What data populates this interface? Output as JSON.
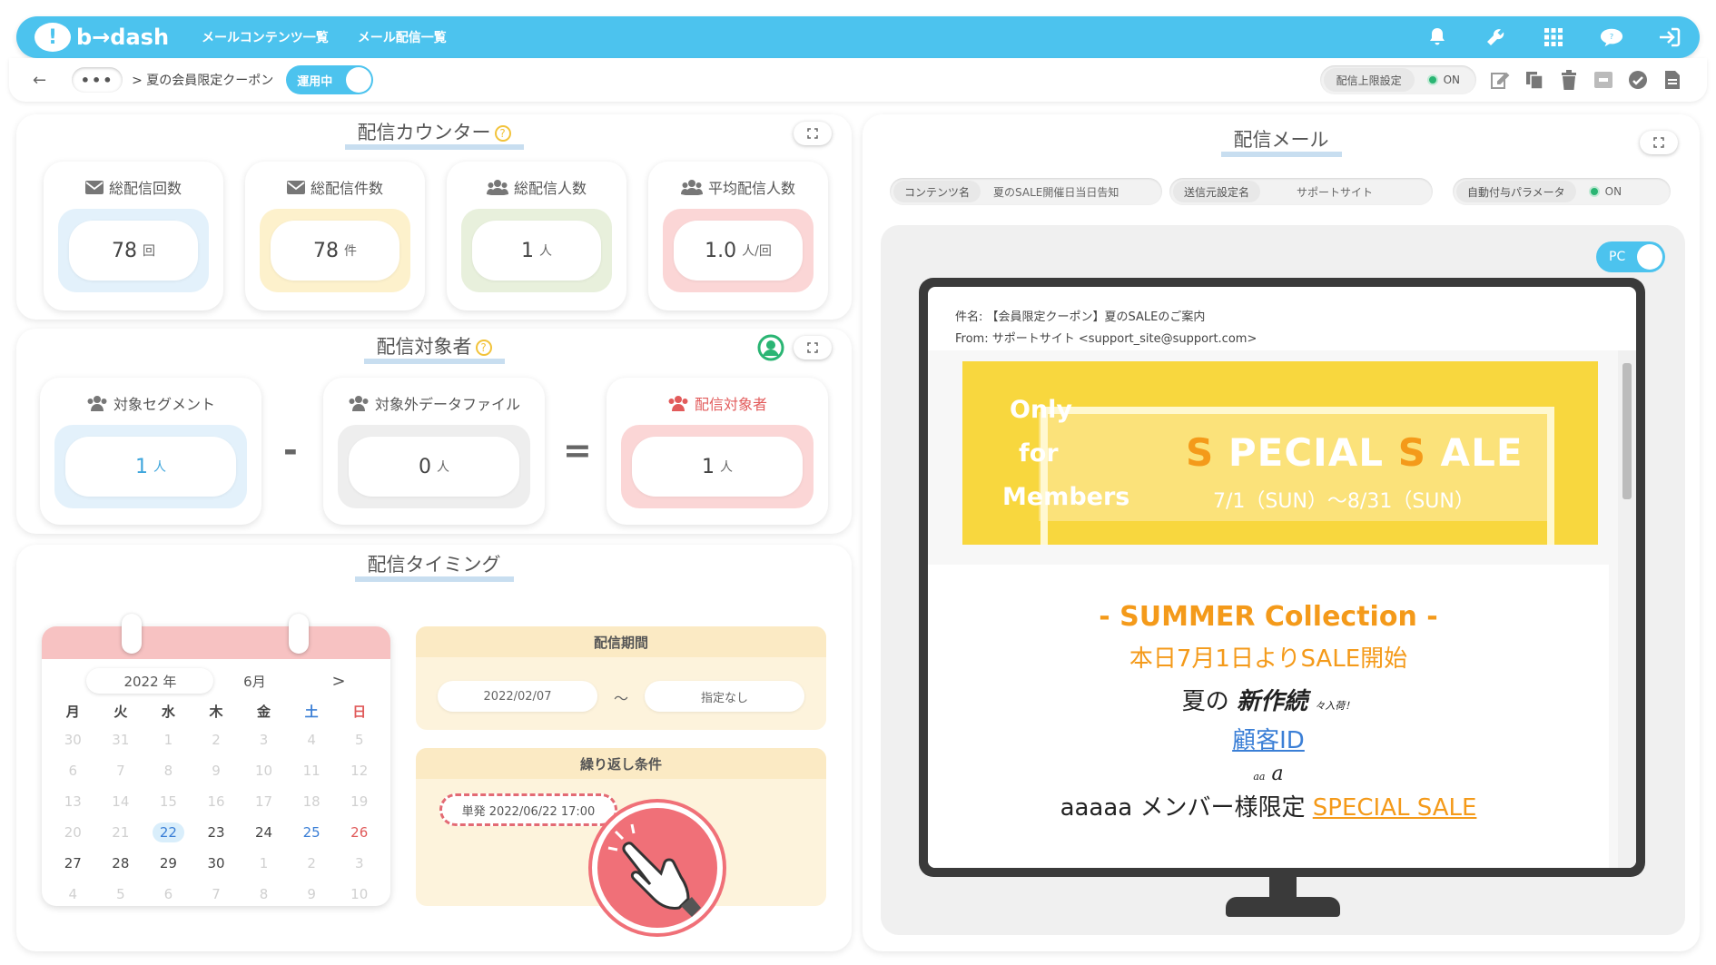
{
  "nav": {
    "logo_text": "b→dash",
    "links": [
      "メールコンテンツ一覧",
      "メール配信一覧"
    ],
    "icons": [
      "bell-icon",
      "wrench-icon",
      "grid-icon",
      "chat-icon",
      "logout-icon"
    ]
  },
  "subbar": {
    "more": "•••",
    "breadcrumb": "> 夏の会員限定クーポン",
    "status": "運用中",
    "limit_label": "配信上限設定",
    "limit_state": "ON",
    "tool_icons": [
      "edit-icon",
      "copy-icon",
      "trash-icon",
      "archive-icon",
      "check-icon",
      "document-icon"
    ]
  },
  "counter": {
    "title": "配信カウンター",
    "help": "?",
    "cards": [
      {
        "label": "総配信回数",
        "value": "78",
        "unit": "回",
        "icon": "envelope-icon",
        "color": "#e3f1fb"
      },
      {
        "label": "総配信件数",
        "value": "78",
        "unit": "件",
        "icon": "envelope-icon",
        "color": "#fdf1cc"
      },
      {
        "label": "総配信人数",
        "value": "1",
        "unit": "人",
        "icon": "group-icon",
        "color": "#e8f0dc"
      },
      {
        "label": "平均配信人数",
        "value": "1.0",
        "unit": "人/回",
        "icon": "group-icon",
        "color": "#fbd6d6"
      }
    ]
  },
  "target": {
    "title": "配信対象者",
    "help": "?",
    "cards": [
      {
        "label": "対象セグメント",
        "value": "1",
        "unit": "人",
        "color": "#e3f1fb",
        "value_color": "#3fa6dc"
      },
      {
        "label": "対象外データファイル",
        "value": "0",
        "unit": "人",
        "color": "#eeeeee",
        "value_color": "#555555"
      },
      {
        "label": "配信対象者",
        "value": "1",
        "unit": "人",
        "color": "#fbd6d6",
        "value_color": "#555555",
        "label_color": "#e25b5b"
      }
    ],
    "minus": "-",
    "equals": "="
  },
  "timing": {
    "title": "配信タイミング",
    "calendar": {
      "year": "2022 年",
      "month": "6月",
      "next": ">",
      "dow": [
        "月",
        "火",
        "水",
        "木",
        "金",
        "土",
        "日"
      ],
      "weeks": [
        [
          "30",
          "31",
          "1",
          "2",
          "3",
          "4",
          "5"
        ],
        [
          "6",
          "7",
          "8",
          "9",
          "10",
          "11",
          "12"
        ],
        [
          "13",
          "14",
          "15",
          "16",
          "17",
          "18",
          "19"
        ],
        [
          "20",
          "21",
          "22",
          "23",
          "24",
          "25",
          "26"
        ],
        [
          "27",
          "28",
          "29",
          "30",
          "1",
          "2",
          "3"
        ],
        [
          "4",
          "5",
          "6",
          "7",
          "8",
          "9",
          "10"
        ]
      ]
    },
    "period_title": "配信期間",
    "period_start": "2022/02/07",
    "period_sep": "～",
    "period_end": "指定なし",
    "repeat_title": "繰り返し条件",
    "repeat_value": "単発 2022/06/22 17:00"
  },
  "mail": {
    "title": "配信メール",
    "content_name_label": "コンテンツ名",
    "content_name_value": "夏のSALE開催日当日告知",
    "sender_label": "送信元設定名",
    "sender_value": "サポートサイト",
    "param_label": "自動付与パラメータ",
    "param_state": "ON",
    "pc_label": "PC",
    "subject": "件名: 【会員限定クーポン】夏のSALEのご案内",
    "from": "From: サポートサイト <support_site@support.com>",
    "banner_only": [
      "Only",
      "for",
      "Members"
    ],
    "banner_sale_s1": "S",
    "banner_sale_mid1": " PECIAL ",
    "banner_sale_s2": "S",
    "banner_sale_mid2": " ALE",
    "banner_date": "7/1（SUN）～8/31（SUN）",
    "line1": "- SUMMER Collection -",
    "line2": "本日7月1日よりSALE開始",
    "line3a": "夏の",
    "line3b": "新作続",
    "line3c": "々入荷！",
    "line4": "顧客ID",
    "line5a": "aa",
    "line5b": "a",
    "line6a": "aaaaa メンバー様限定 ",
    "line6b": "SPECIAL SALE"
  }
}
